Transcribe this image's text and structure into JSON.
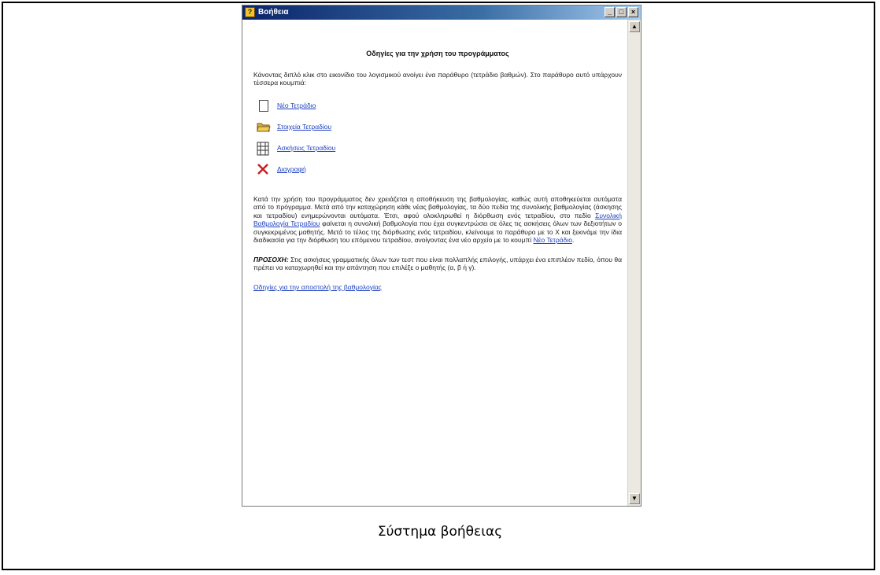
{
  "window": {
    "title": "Βοήθεια",
    "buttons": {
      "minimize": "_",
      "maximize": "□",
      "close": "×"
    },
    "scroll_up": "▲",
    "scroll_down": "▼"
  },
  "help": {
    "heading": "Οδηγίες για την χρήση του προγράμματος",
    "intro": "Κάνοντας διπλό κλικ στο εικονίδιο του λογισμικού ανοίγει ένα παράθυρο (τετράδιο βαθμών). Στο παράθυρο αυτό υπάρχουν τέσσερα κουμπιά:",
    "buttons": [
      {
        "icon": "new-page-icon",
        "label": "Νέο Τετράδιο"
      },
      {
        "icon": "folder-icon",
        "label": "Στοιχεία Τετραδίου"
      },
      {
        "icon": "grid-icon",
        "label": "Ασκήσεις Τετραδίου"
      },
      {
        "icon": "delete-x-icon",
        "label": "Διαγραφή"
      }
    ],
    "body_pre": "Κατά την χρήση του προγράμματος δεν χρειάζεται η αποθήκευση της βαθμολογίας, καθώς αυτή αποθηκεύεται αυτόματα από το πρόγραμμα. Μετά από την καταχώρηση κάθε νέας βαθμολογίας, τα δύο πεδία της συνολικής βαθμολογίας (άσκησης και τετραδίου) ενημερώνονται αυτόματα. Έτσι, αφού ολοκληρωθεί η διόρθωση ενός τετραδίου, στο πεδίο ",
    "body_link1": "Συνολική Βαθμολογία Τετραδίου",
    "body_mid": " φαίνεται η συνολική βαθμολογία που έχει συγκεντρώσει σε όλες τις ασκήσεις όλων των δεξιοτήτων ο συγκεκριμένος μαθητής. Μετά το τέλος της διόρθωσης ενός τετραδίου, κλείνουμε το παράθυρο με το X και ξεκινάμε την ίδια διαδικασία για την διόρθωση του επόμενου τετραδίου, ανοίγοντας ένα νέο αρχείο με το κουμπί ",
    "body_link2": "Νέο Τετράδιο",
    "body_end": ".",
    "note_label": "ΠΡΟΣΟΧΗ:",
    "note_text": " Στις ασκήσεις γραμματικής όλων των τεστ που είναι πολλαπλής επιλογής, υπάρχει ένα επιπλέον πεδίο, όπου θα πρέπει να καταχωρηθεί και την απάντηση που επιλέξε ο μαθητής (α, β ή γ).",
    "footer_link": "Οδηγίες για την αποστολή της βαθμολογίας"
  },
  "caption": "Σύστημα βοήθειας"
}
